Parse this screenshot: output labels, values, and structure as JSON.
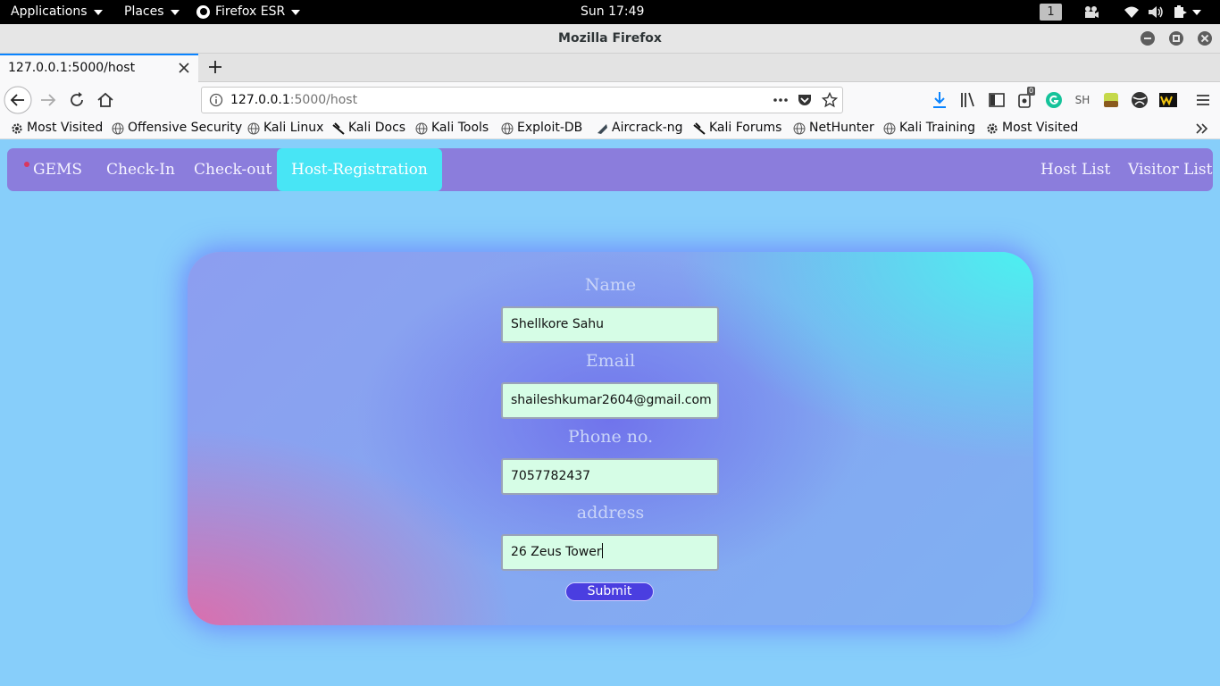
{
  "top_panel": {
    "applications_label": "Applications",
    "places_label": "Places",
    "firefox_label": "Firefox ESR",
    "clock": "Sun 17:49",
    "workspace": "1"
  },
  "window": {
    "title": "Mozilla Firefox"
  },
  "tab": {
    "title": "127.0.0.1:5000/host"
  },
  "urlbar": {
    "host": "127.0.0.1",
    "path": ":5000/host"
  },
  "toolbar": {
    "extension_badge": "0",
    "sh_label": "SH"
  },
  "bookmarks": [
    {
      "label": "Most Visited",
      "icon": "gear-icon"
    },
    {
      "label": "Offensive Security",
      "icon": "globe-icon"
    },
    {
      "label": "Kali Linux",
      "icon": "globe-icon"
    },
    {
      "label": "Kali Docs",
      "icon": "kali-dragon-icon"
    },
    {
      "label": "Kali Tools",
      "icon": "globe-icon"
    },
    {
      "label": "Exploit-DB",
      "icon": "globe-icon"
    },
    {
      "label": "Aircrack-ng",
      "icon": "aircrack-icon"
    },
    {
      "label": "Kali Forums",
      "icon": "kali-dragon-icon"
    },
    {
      "label": "NetHunter",
      "icon": "globe-icon"
    },
    {
      "label": "Kali Training",
      "icon": "globe-icon"
    },
    {
      "label": "Most Visited",
      "icon": "gear-icon"
    }
  ],
  "app_nav": {
    "brand": "GEMS",
    "checkin": "Check-In",
    "checkout": "Check-out",
    "host_registration": "Host-Registration",
    "host_list": "Host List",
    "visitor_list": "Visitor List"
  },
  "form": {
    "name_label": "Name",
    "name_value": "Shellkore Sahu",
    "email_label": "Email",
    "email_value": "shaileshkumar2604@gmail.com",
    "phone_label": "Phone no.",
    "phone_value": "7057782437",
    "address_label": "address",
    "address_value": "26 Zeus Tower",
    "submit_label": "Submit"
  },
  "colors": {
    "nav_bg": "#8b7ddc",
    "nav_active": "#48e5f5",
    "page_bg": "#87cefa",
    "input_bg": "#d6fde6",
    "submit_bg": "#4a3ee0"
  }
}
